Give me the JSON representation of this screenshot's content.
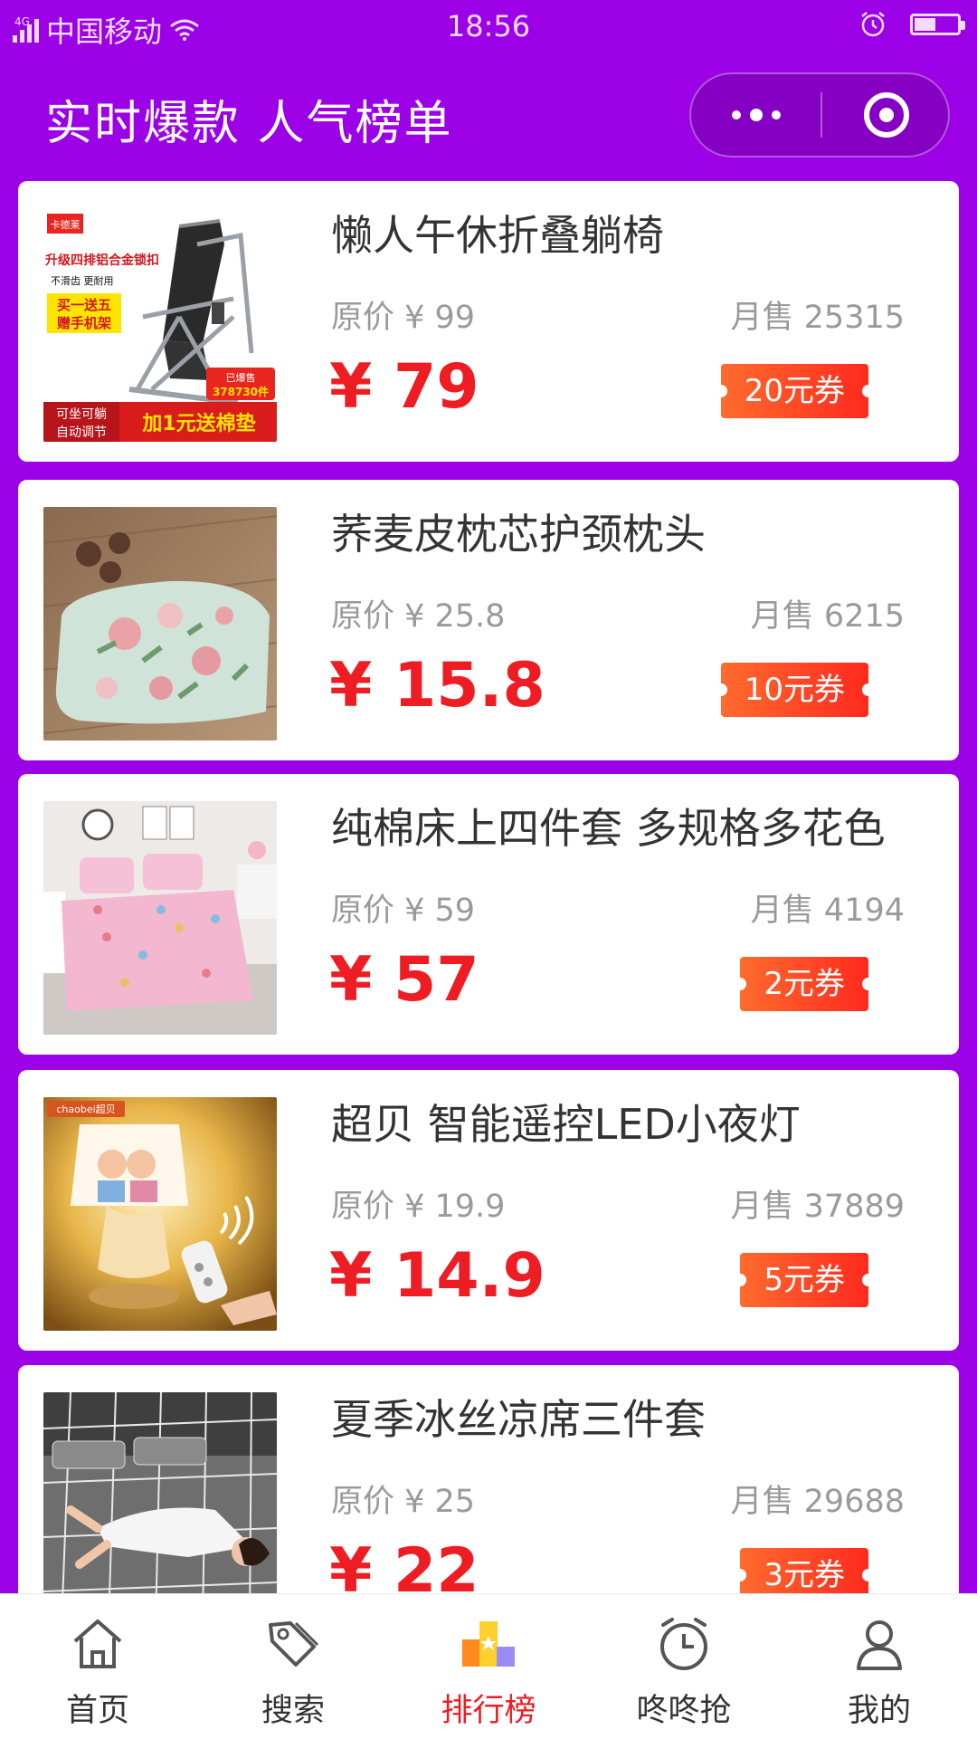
{
  "status_bar": {
    "network": "4G",
    "carrier": "中国移动",
    "time": "18:56",
    "battery_level": 0.5
  },
  "header": {
    "title": "实时爆款 人气榜单",
    "more_icon": "more-dots-icon",
    "close_icon": "target-icon"
  },
  "products": [
    {
      "title": "懒人午休折叠躺椅",
      "original_price": "原价 ¥ 99",
      "monthly_sales": "月售 25315",
      "price": "¥ 79",
      "coupon": "20元券",
      "image": {
        "brand": "卡德莱",
        "headline": "升级四排铝合金锁扣",
        "sub": "不滑齿 更耐用",
        "promo1": "买一送五",
        "promo2": "赠手机架",
        "sold_label": "已爆售",
        "sold_count": "378730件",
        "feature1": "可坐可躺",
        "feature2": "自动调节",
        "gift": "加1元送棉垫"
      }
    },
    {
      "title": "荞麦皮枕芯护颈枕头",
      "original_price": "原价 ¥ 25.8",
      "monthly_sales": "月售 6215",
      "price": "¥ 15.8",
      "coupon": "10元券"
    },
    {
      "title": "纯棉床上四件套 多规格多花色",
      "original_price": "原价 ¥ 59",
      "monthly_sales": "月售 4194",
      "price": "¥ 57",
      "coupon": "2元券"
    },
    {
      "title": "超贝 智能遥控LED小夜灯",
      "original_price": "原价 ¥ 19.9",
      "monthly_sales": "月售 37889",
      "price": "¥ 14.9",
      "coupon": "5元券",
      "image": {
        "brand": "chaobei超贝"
      }
    },
    {
      "title": "夏季冰丝凉席三件套",
      "original_price": "原价 ¥ 25",
      "monthly_sales": "月售 29688",
      "price": "¥ 22",
      "coupon": "3元券"
    }
  ],
  "tab_bar": {
    "tabs": [
      {
        "label": "首页",
        "icon": "home-icon",
        "active": false
      },
      {
        "label": "搜索",
        "icon": "tag-icon",
        "active": false
      },
      {
        "label": "排行榜",
        "icon": "ranking-icon",
        "active": true
      },
      {
        "label": "咚咚抢",
        "icon": "alarm-clock-icon",
        "active": false
      },
      {
        "label": "我的",
        "icon": "user-icon",
        "active": false
      }
    ]
  },
  "colors": {
    "background": "#9b00e6",
    "price_red": "#ee1d23",
    "coupon_start": "#ff6b2e",
    "coupon_end": "#ff2a1e",
    "active_tab": "#ee1d23"
  }
}
